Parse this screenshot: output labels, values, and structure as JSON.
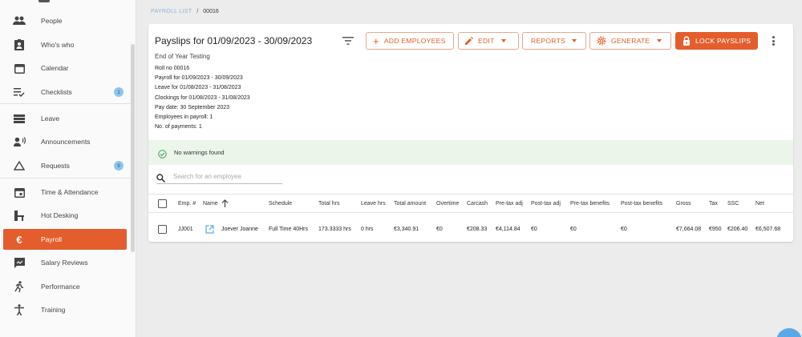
{
  "sidebar": {
    "items": [
      {
        "label": "People",
        "icon": "people-icon",
        "badge": ""
      },
      {
        "label": "Who's who",
        "icon": "contact-card-icon",
        "badge": ""
      },
      {
        "label": "Calendar",
        "icon": "calendar-icon",
        "badge": ""
      },
      {
        "label": "Checklists",
        "icon": "checklist-icon",
        "badge": "1"
      },
      {
        "label": "Leave",
        "icon": "leave-icon",
        "badge": ""
      },
      {
        "label": "Announcements",
        "icon": "megaphone-icon",
        "badge": ""
      },
      {
        "label": "Requests",
        "icon": "triangle-icon",
        "badge": "9"
      },
      {
        "label": "Time & Attendance",
        "icon": "calendar-clock-icon",
        "badge": ""
      },
      {
        "label": "Hot Desking",
        "icon": "desk-icon",
        "badge": ""
      },
      {
        "label": "Payroll",
        "icon": "euro-icon",
        "badge": "",
        "active": true
      },
      {
        "label": "Salary Reviews",
        "icon": "review-icon",
        "badge": ""
      },
      {
        "label": "Performance",
        "icon": "running-icon",
        "badge": ""
      },
      {
        "label": "Training",
        "icon": "training-icon",
        "badge": ""
      }
    ]
  },
  "breadcrumb": {
    "root": "PAYROLL LIST",
    "separator": "/",
    "current": "00016"
  },
  "header": {
    "title": "Payslips for 01/09/2023 - 30/09/2023",
    "add_employees": "ADD EMPLOYEES",
    "edit": "EDIT",
    "reports": "REPORTS",
    "generate": "GENERATE",
    "lock_payslips": "LOCK PAYSLIPS"
  },
  "details": {
    "subtitle": "End of Year Testing",
    "lines": [
      "Roll no 00016",
      "Payroll for 01/09/2023 - 30/09/2023",
      "Leave for 01/08/2023 - 31/08/2023",
      "Clockings for 01/08/2023 - 31/08/2023",
      "Pay date: 30 September 2023",
      "Employees in payroll: 1",
      "No. of payments: 1"
    ]
  },
  "warnings": {
    "text": "No warnings found"
  },
  "search": {
    "placeholder": "Search for an employee"
  },
  "table": {
    "columns": [
      "Emp. #",
      "Name",
      "Schedule",
      "Total hrs",
      "Leave hrs",
      "Total amount",
      "Overtime",
      "Carcash",
      "Pre-tax adj",
      "Post-tax adj",
      "Pre-tax benefits",
      "Post-tax benefits",
      "Gross",
      "Tax",
      "SSC",
      "Net"
    ],
    "rows": [
      [
        "JJ001",
        "Joever Joanne",
        "Full Time 40Hrs",
        "173.3333 hrs",
        "0 hrs",
        "€3,340.91",
        "€0",
        "€208.33",
        "€4,114.84",
        "€0",
        "€0",
        "€0",
        "€7,664.08",
        "€950",
        "€206.40",
        "€6,507.68"
      ]
    ]
  },
  "colors": {
    "accent": "#e35e2c",
    "badge": "#8ec6ea",
    "success_bg": "#ebf5ea"
  }
}
